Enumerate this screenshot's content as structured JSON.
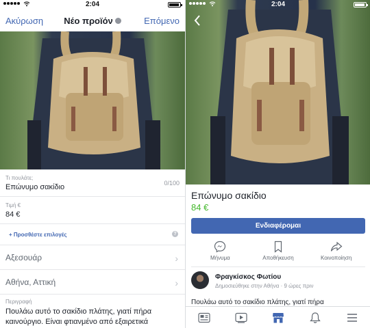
{
  "status": {
    "time": "2:04"
  },
  "left": {
    "nav": {
      "cancel": "Ακύρωση",
      "title": "Νέο προϊόν",
      "next": "Επόμενο"
    },
    "form": {
      "what_label": "Τι πουλάτε;",
      "what_value": "Επώνυμο σακίδιο",
      "char_counter": "0/100",
      "price_label": "Τιμή €",
      "price_value": "84 €",
      "add_options": "+ Προσθέστε επιλογές",
      "help_icon": "?",
      "category": "Αξεσουάρ",
      "location": "Αθήνα, Αττική",
      "description_label": "Περιγραφή",
      "description_text": "Πουλάω αυτό το σακίδιο πλάτης, γιατί πήρα καινούργιο. Είναι φτιανμένο από εξαιρετικά"
    }
  },
  "right": {
    "product": {
      "title": "Επώνυμο σακίδιο",
      "price": "84 €"
    },
    "interest_button": "Ενδιαφέρομαι",
    "actions": [
      {
        "icon": "messenger-icon",
        "label": "Μήνυμα"
      },
      {
        "icon": "bookmark-icon",
        "label": "Αποθήκευση"
      },
      {
        "icon": "share-icon",
        "label": "Κοινοποίηση"
      }
    ],
    "seller": {
      "name": "Φραγκίσκος Φωτίου",
      "meta": "Δημοσιεύθηκε στην Αθήνα · 9 ώρες πριν"
    },
    "description": "Πουλάω αυτό το σακίδιο πλάτης, γιατί πήρα",
    "tabbar": [
      "news-feed-icon",
      "video-icon",
      "marketplace-icon",
      "notifications-icon",
      "menu-icon"
    ]
  },
  "colors": {
    "accent": "#4267b2",
    "price": "#42b72a",
    "muted": "#90949c"
  }
}
